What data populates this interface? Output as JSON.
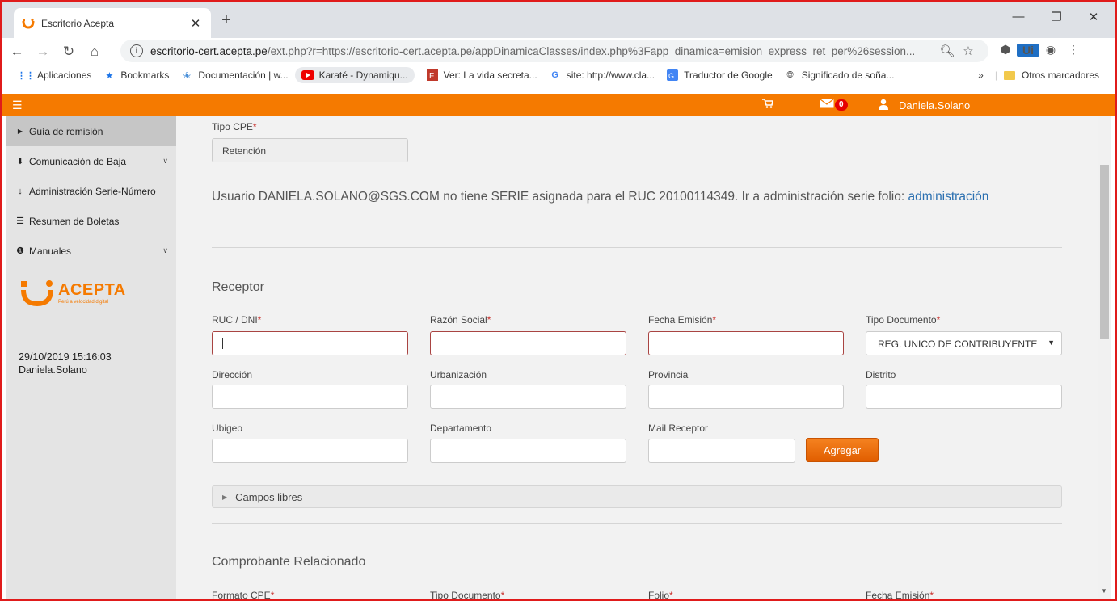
{
  "browser": {
    "tab_title": "Escritorio Acepta",
    "tab_close": "✕",
    "new_tab": "+",
    "url_host": "escritorio-cert.acepta.pe",
    "url_path": "/ext.php?r=https://escritorio-cert.acepta.pe/appDinamicaClasses/index.php%3Fapp_dinamica=emision_express_ret_per%26session..."
  },
  "bookmarks": {
    "items": [
      {
        "label": "Aplicaciones",
        "icon": "apps-grid-icon"
      },
      {
        "label": "Bookmarks",
        "icon": "star-icon"
      },
      {
        "label": "Documentación | w...",
        "icon": "doc-icon"
      },
      {
        "label": "Karaté - Dynamiqu...",
        "icon": "youtube-icon"
      },
      {
        "label": "Ver: La vida secreta...",
        "icon": "site-icon"
      },
      {
        "label": "site: http://www.cla...",
        "icon": "google-icon"
      },
      {
        "label": "Traductor de Google",
        "icon": "translate-icon"
      },
      {
        "label": "Significado de soña...",
        "icon": "globe-icon"
      }
    ],
    "more": "»",
    "other": "Otros marcadores"
  },
  "header": {
    "mail_count": "0",
    "user": "Daniela.Solano",
    "brand_color": "#f57a00"
  },
  "sidebar": {
    "items": [
      {
        "label": "Guía de remisión"
      },
      {
        "label": "Comunicación de Baja"
      },
      {
        "label": "Administración Serie-Número"
      },
      {
        "label": "Resumen de Boletas"
      },
      {
        "label": "Manuales"
      }
    ],
    "logo": "ACEPTA",
    "logo_tagline": "Perú a velocidad digital",
    "datetime": "29/10/2019 15:16:03",
    "username": "Daniela.Solano"
  },
  "form": {
    "tipo_cpe_label": "Tipo CPE",
    "tipo_cpe_value": "Retención",
    "required_mark": "*",
    "notice_text": "Usuario DANIELA.SOLANO@SGS.COM no tiene SERIE asignada para el RUC 20100114349. Ir a administración serie folio: ",
    "notice_link": "administración",
    "receptor_title": "Receptor",
    "ruc_label": "RUC / DNI",
    "razon_label": "Razón Social",
    "fecha_label": "Fecha Emisión",
    "tipodoc_label": "Tipo Documento",
    "tipodoc_value": "REG. UNICO DE CONTRIBUYENTE",
    "direccion_label": "Dirección",
    "urbanizacion_label": "Urbanización",
    "provincia_label": "Provincia",
    "distrito_label": "Distrito",
    "ubigeo_label": "Ubigeo",
    "departamento_label": "Departamento",
    "mail_label": "Mail Receptor",
    "agregar_label": "Agregar",
    "campos_libres": "Campos libres",
    "comprobante_title": "Comprobante Relacionado",
    "formato_label": "Formato CPE",
    "tipodoc2_label": "Tipo Documento",
    "folio_label": "Folio",
    "fecha2_label": "Fecha Emisión"
  }
}
